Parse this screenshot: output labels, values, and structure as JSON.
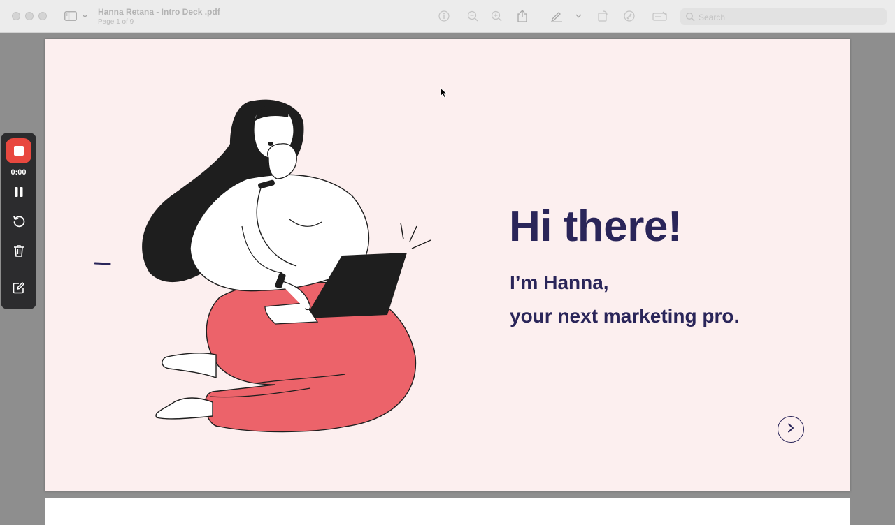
{
  "window": {
    "title": "Hanna Retana - Intro Deck .pdf",
    "page_indicator": "Page 1 of 9"
  },
  "toolbar": {
    "icons": [
      "sidebar-toggle-icon",
      "chevron-down-icon",
      "info-icon",
      "zoom-out-icon",
      "zoom-in-icon",
      "share-icon",
      "markup-pen-icon",
      "chevron-down-icon",
      "rotate-icon",
      "annotate-icon",
      "form-fill-icon",
      "search-icon"
    ],
    "search_placeholder": "Search"
  },
  "slide": {
    "heading": "Hi there!",
    "line1": "I’m Hanna,",
    "line2": "your next marketing pro.",
    "next_icon": "chevron-right-icon",
    "colors": {
      "background": "#fcefef",
      "text": "#2a2559",
      "pants": "#ec636a",
      "hair": "#1e1e1e"
    }
  },
  "recorder": {
    "time": "0:00",
    "controls": [
      "stop-icon",
      "pause-icon",
      "restart-icon",
      "trash-icon",
      "edit-icon"
    ],
    "accent": "#e8483f"
  }
}
